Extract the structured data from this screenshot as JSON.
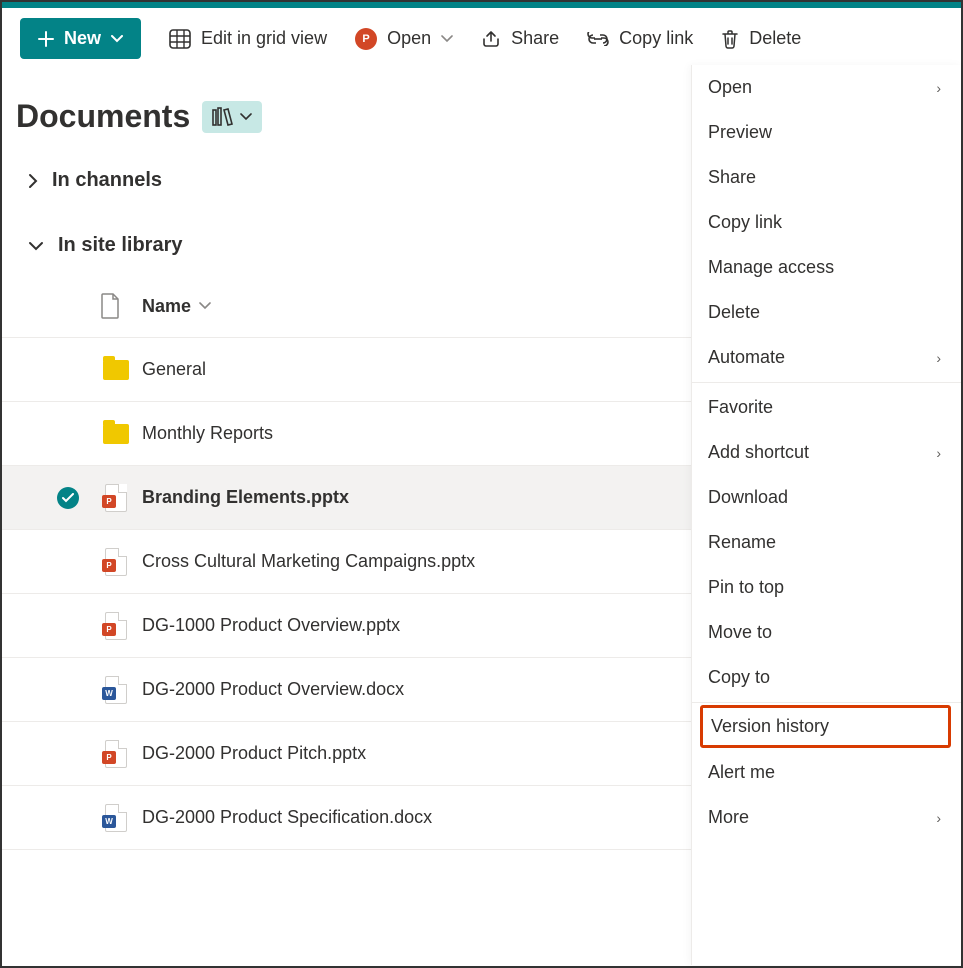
{
  "toolbar": {
    "new_label": "New",
    "edit_grid_label": "Edit in grid view",
    "open_label": "Open",
    "share_label": "Share",
    "copy_link_label": "Copy link",
    "delete_label": "Delete"
  },
  "page": {
    "title": "Documents"
  },
  "sections": {
    "in_channels": "In channels",
    "in_library": "In site library"
  },
  "columns": {
    "name": "Name"
  },
  "rows": [
    {
      "type": "folder",
      "name": "General"
    },
    {
      "type": "folder",
      "name": "Monthly Reports"
    },
    {
      "type": "pptx",
      "name": "Branding Elements.pptx",
      "selected": true
    },
    {
      "type": "pptx",
      "name": "Cross Cultural Marketing Campaigns.pptx"
    },
    {
      "type": "pptx",
      "name": "DG-1000 Product Overview.pptx"
    },
    {
      "type": "docx",
      "name": "DG-2000 Product Overview.docx"
    },
    {
      "type": "pptx",
      "name": "DG-2000 Product Pitch.pptx"
    },
    {
      "type": "docx",
      "name": "DG-2000 Product Specification.docx"
    }
  ],
  "context_menu": {
    "open": "Open",
    "preview": "Preview",
    "share": "Share",
    "copy_link": "Copy link",
    "manage_access": "Manage access",
    "delete": "Delete",
    "automate": "Automate",
    "favorite": "Favorite",
    "add_shortcut": "Add shortcut",
    "download": "Download",
    "rename": "Rename",
    "pin_to_top": "Pin to top",
    "move_to": "Move to",
    "copy_to": "Copy to",
    "version_history": "Version history",
    "alert_me": "Alert me",
    "more": "More"
  }
}
